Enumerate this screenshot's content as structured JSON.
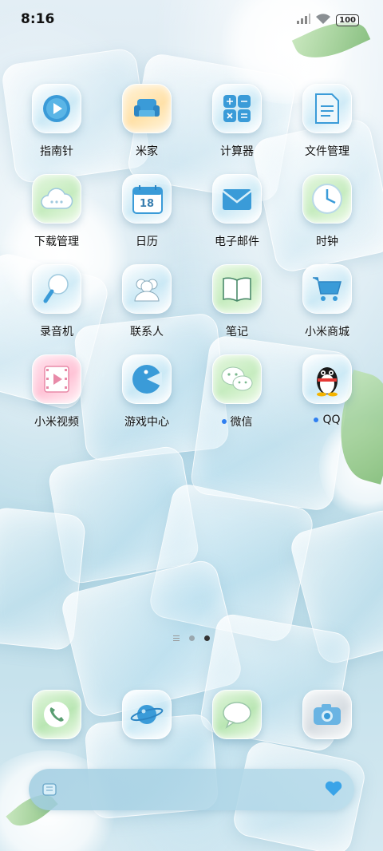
{
  "status_bar": {
    "time": "8:16",
    "battery": "100"
  },
  "apps": [
    {
      "label": "指南针",
      "icon": "compass-icon",
      "dot": false
    },
    {
      "label": "米家",
      "icon": "sofa-icon",
      "dot": false
    },
    {
      "label": "计算器",
      "icon": "calculator-icon",
      "dot": false
    },
    {
      "label": "文件管理",
      "icon": "document-icon",
      "dot": false
    },
    {
      "label": "下载管理",
      "icon": "cloud-icon",
      "dot": false
    },
    {
      "label": "日历",
      "icon": "calendar-icon",
      "calendar_day": "18",
      "dot": false
    },
    {
      "label": "电子邮件",
      "icon": "envelope-icon",
      "dot": false
    },
    {
      "label": "时钟",
      "icon": "clock-icon",
      "dot": false
    },
    {
      "label": "录音机",
      "icon": "microphone-icon",
      "dot": false
    },
    {
      "label": "联系人",
      "icon": "contacts-icon",
      "dot": false
    },
    {
      "label": "笔记",
      "icon": "book-icon",
      "dot": false
    },
    {
      "label": "小米商城",
      "icon": "shopping-cart-icon",
      "dot": false
    },
    {
      "label": "小米视频",
      "icon": "video-icon",
      "dot": false
    },
    {
      "label": "游戏中心",
      "icon": "game-pacman-icon",
      "dot": false
    },
    {
      "label": "微信",
      "icon": "wechat-icon",
      "dot": true
    },
    {
      "label": "QQ",
      "icon": "penguin-icon",
      "dot": true
    }
  ],
  "dock": [
    {
      "icon": "phone-icon"
    },
    {
      "icon": "planet-browser-icon"
    },
    {
      "icon": "message-bubble-icon"
    },
    {
      "icon": "camera-icon"
    }
  ],
  "page_indicator": {
    "pages": 2,
    "active": 2
  },
  "search_bar": {
    "left_icon": "ice-cube-icon",
    "right_icon": "heart-icon"
  },
  "colors": {
    "notification_dot": "#2f7ff0",
    "icon_blue": "#3a9bd8"
  }
}
